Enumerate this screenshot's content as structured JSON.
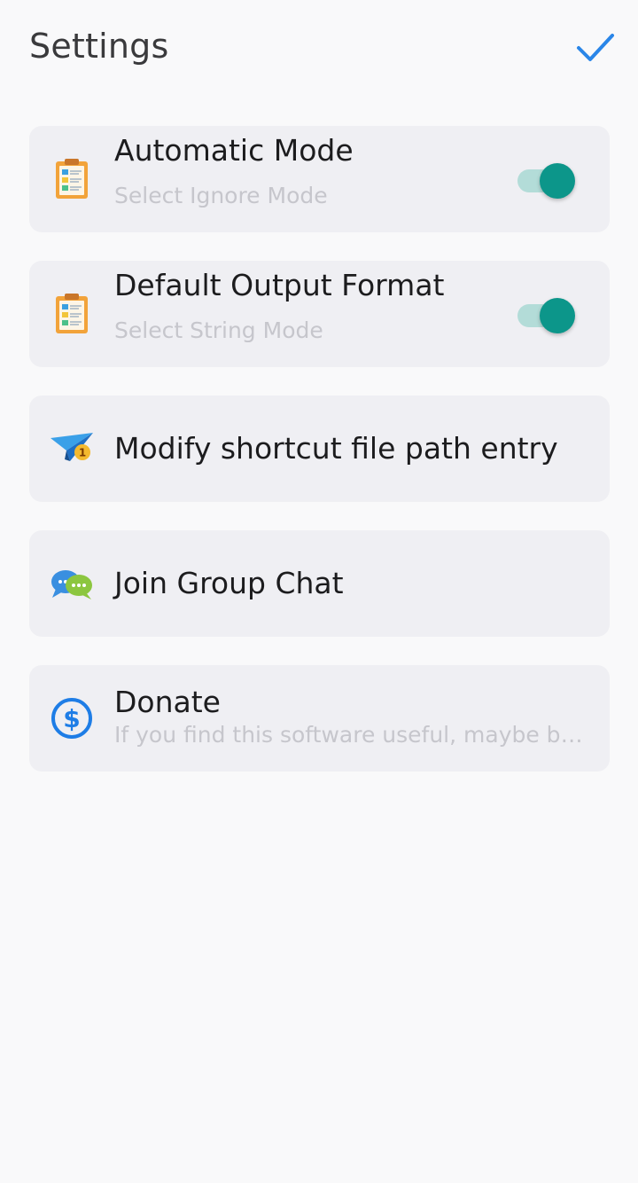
{
  "header": {
    "title": "Settings",
    "confirm_icon": "checkmark-icon",
    "accent_color": "#2a86e8"
  },
  "items": [
    {
      "icon": "clipboard-icon",
      "label": "Automatic Mode",
      "sub": "Select Ignore Mode",
      "toggle_on": true
    },
    {
      "icon": "clipboard-icon",
      "label": "Default Output Format",
      "sub": "Select String Mode",
      "toggle_on": true
    },
    {
      "icon": "paper-plane-icon",
      "label": "Modify shortcut file path entry"
    },
    {
      "icon": "chat-bubbles-icon",
      "label": "Join Group Chat"
    },
    {
      "icon": "dollar-icon",
      "label": "Donate",
      "sub": "If you find this software useful, maybe buy me a coffee"
    }
  ],
  "colors": {
    "toggle_track": "#b3dcd8",
    "toggle_thumb": "#0c968a",
    "card_bg": "#efeff3",
    "page_bg": "#f9f9fa"
  }
}
